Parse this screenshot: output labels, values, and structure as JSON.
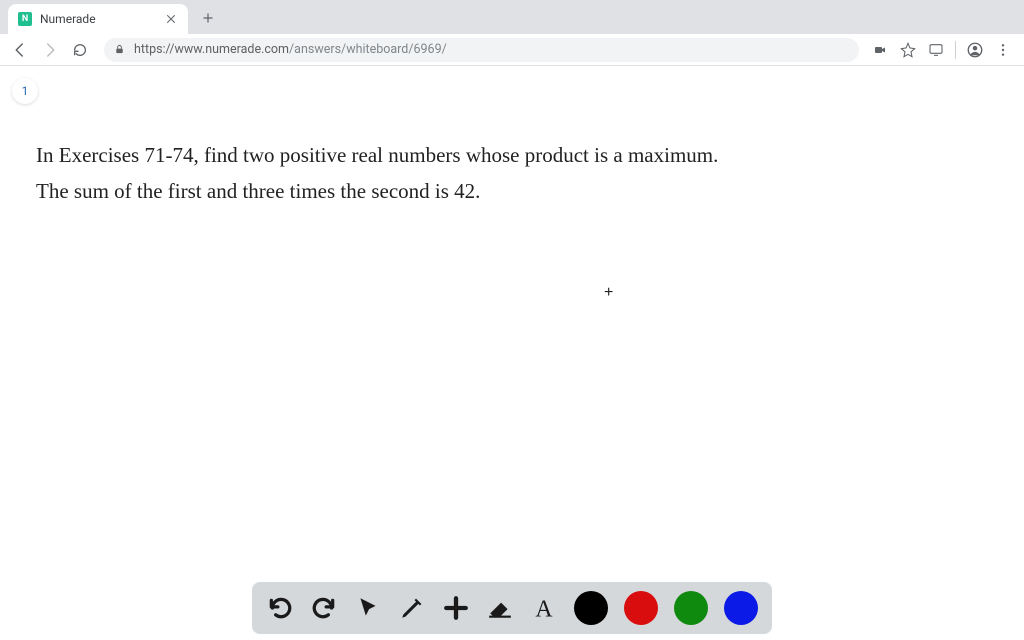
{
  "browser": {
    "tab": {
      "title": "Numerade",
      "favicon_letter": "N"
    },
    "url": {
      "host": "https://www.numerade.com",
      "path": "/answers/whiteboard/6969/"
    }
  },
  "page_indicator": "1",
  "problem": {
    "line1": "In Exercises 71-74, find two positive real numbers whose product is a maximum.",
    "line2": "The sum of the first and three times the second is 42."
  },
  "cursor_glyph": "+",
  "toolbar_colors": {
    "black": "#000000",
    "red": "#d90d0d",
    "green": "#0f8a0f",
    "blue": "#0b1ae6"
  }
}
